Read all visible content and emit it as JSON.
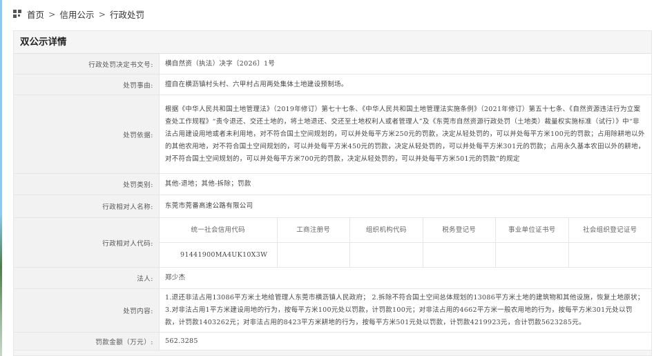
{
  "breadcrumb": {
    "home": "首页",
    "sep": ">",
    "level2": "信用公示",
    "level3": "行政处罚"
  },
  "panel": {
    "title": "双公示详情"
  },
  "rows": {
    "decision_no": {
      "label": "行政处罚决定书文号:",
      "value": "横自然资（执法）决字〔2026〕1号"
    },
    "reason": {
      "label": "处罚事由:",
      "value": "擅自在横沥镇村头村、六甲村占用两处集体土地建设预制场。"
    },
    "basis": {
      "label": "处罚依据:",
      "value": "根据《中华人民共和国土地管理法》（2019年修订）第七十七条、《中华人民共和国土地管理法实施条例》（2021年修订）第五十七条、《自然资源违法行为立案查处工作规程》“责令退还、交还土地的，将土地退还、交还至土地权利人或者管理人”及《东莞市自然资源行政处罚（土地类）裁量权实施标准（试行）》中“非法占用建设用地或者未利用地，对不符合国土空间规划的，可以并处每平方米250元的罚款，决定从轻处罚的，可以并处每平方米100元的罚款；占用除耕地以外的其他农用地，对不符合国土空间规划的，可以并处每平方米450元的罚款，决定从轻处罚的，可以并处每平方米301元的罚款；占用永久基本农田以外的耕地，对不符合国土空间规划的，可以并处每平方米700元的罚款，决定从轻处罚的，可以并处每平方米501元的罚款”的规定"
    },
    "category": {
      "label": "处罚类别:",
      "value": "其他-退地；其他-拆除；罚款"
    },
    "party_name": {
      "label": "行政相对人名称:",
      "value": "东莞市莞番高速公路有限公司"
    },
    "party_code": {
      "label": "行政相对人代码:",
      "headers": [
        "统一社会信用代码",
        "工商注册号",
        "组织机构代码",
        "税务登记号",
        "事业单位证书号",
        "社会组织登记证号"
      ],
      "values": [
        "91441900MA4UK10X3W",
        "",
        "",
        "",
        "",
        ""
      ]
    },
    "legal_rep": {
      "label": "法人:",
      "value": "郑少杰"
    },
    "content": {
      "label": "处罚内容:",
      "value": "1.退还非法占用13086平方米土地给管理人东莞市横沥镇人民政府； 2.拆除不符合国土空间总体规划的13086平方米土地的建筑物和其他设施，恢复土地原状； 3.对非法占用1平方米建设用地的行为，按每平方米100元处以罚款，计罚款100元；对非法占用的4662平方米一般农用地的行为，按每平方米301元处以罚款，计罚款1403262元；对非法占用的8423平方米耕地的行为，按每平方米501元处以罚款，计罚款4219923元，合计罚款5623285元。"
    },
    "fine": {
      "label": "罚款金额（万元）:",
      "value": "562.3285"
    }
  },
  "icons": {
    "home": "home-grid-icon"
  },
  "colors": {
    "panel_bg": "#f5f5f5",
    "label_bg": "#f2f2f2",
    "value_bg": "#ffffff",
    "border": "#e6e6e6"
  }
}
